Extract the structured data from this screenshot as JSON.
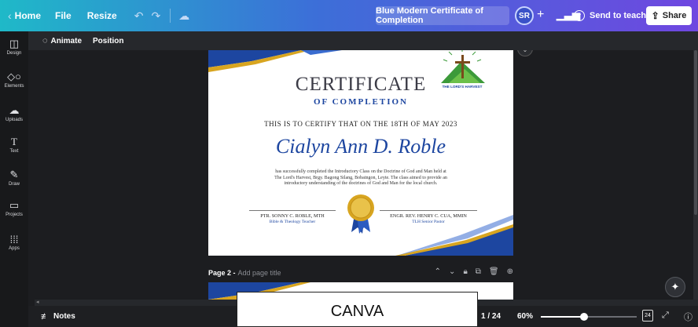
{
  "topbar": {
    "home_label": "Home",
    "file_label": "File",
    "resize_label": "Resize",
    "doc_title": "Blue Modern Certificate of Completion",
    "avatar_initials": "SR",
    "send_label": "Send to teacher",
    "share_label": "Share",
    "gradient_colors": [
      "#1fb9c8",
      "#3c6fd8",
      "#6f47e0"
    ]
  },
  "sidebar": {
    "items": [
      {
        "label": "Design",
        "icon": "layout-icon"
      },
      {
        "label": "Elements",
        "icon": "shapes-icon"
      },
      {
        "label": "Uploads",
        "icon": "cloud-upload-icon"
      },
      {
        "label": "Text",
        "icon": "text-icon"
      },
      {
        "label": "Draw",
        "icon": "pen-icon"
      },
      {
        "label": "Projects",
        "icon": "folder-icon"
      },
      {
        "label": "Apps",
        "icon": "grid-icon"
      }
    ]
  },
  "context": {
    "animate_label": "Animate",
    "position_label": "Position"
  },
  "certificate": {
    "title": "CERTIFICATE",
    "subtitle": "OF COMPLETION",
    "certify_line": "THIS IS TO CERTIFY THAT ON THE 18TH OF MAY 2023",
    "recipient": "Cialyn Ann D. Roble",
    "body": "has successfully completed the Introductory Class on the Doctrine of God and Man held  at The Lord's Harvest, Brgy. Bagong Silang, Bobatngon, Leyte. The class aimed to provide an introductory understanding of the doctrines of God and Man for the local church.",
    "logo_text": "THE LORD'S HARVEST",
    "sig_left_name": "PTR. SONNY C. ROBLE, MTH",
    "sig_left_role": "Bible & Theology Teacher",
    "sig_right_name": "ENGR. REV. HENRY C. CUA, MMIN",
    "sig_right_role": "TLH Senior Pastor",
    "accent_color": "#1d46a0",
    "gold_color": "#d8a520"
  },
  "page2": {
    "label": "Page 2 -",
    "title_placeholder": "Add page title"
  },
  "bottombar": {
    "notes_label": "Notes",
    "page_count": "1 / 24",
    "zoom": "60%",
    "zoom_fraction": 0.45,
    "pages_icon_label": "24"
  },
  "watermark": "CANVA"
}
